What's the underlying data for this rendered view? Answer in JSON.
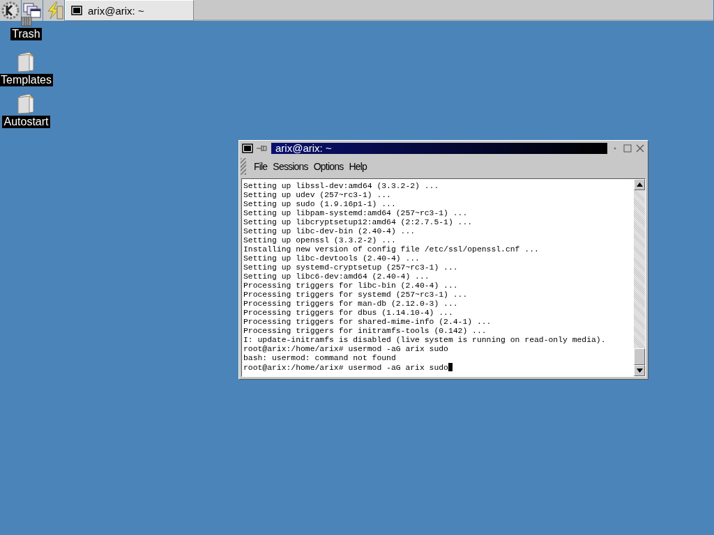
{
  "taskbar": {
    "launchers": [
      {
        "kind": "kmenu"
      },
      {
        "kind": "windows"
      },
      {
        "kind": "lightning"
      }
    ],
    "tasks": [
      {
        "title": "arix@arix: ~",
        "selected": true
      }
    ]
  },
  "desktop_icons": [
    {
      "label": "Trash",
      "kind": "trash"
    },
    {
      "label": "Templates",
      "kind": "folder"
    },
    {
      "label": "Autostart",
      "kind": "folder"
    }
  ],
  "window": {
    "title": "arix@arix: ~",
    "active": true,
    "menu": [
      "File",
      "Sessions",
      "Options",
      "Help"
    ],
    "lines": [
      "Setting up libssl-dev:amd64 (3.3.2-2) ...",
      "Setting up udev (257~rc3-1) ...",
      "Setting up sudo (1.9.16p1-1) ...",
      "Setting up libpam-systemd:amd64 (257~rc3-1) ...",
      "Setting up libcryptsetup12:amd64 (2:2.7.5-1) ...",
      "Setting up libc-dev-bin (2.40-4) ...",
      "Setting up openssl (3.3.2-2) ...",
      "Installing new version of config file /etc/ssl/openssl.cnf ...",
      "Setting up libc-devtools (2.40-4) ...",
      "Setting up systemd-cryptsetup (257~rc3-1) ...",
      "Setting up libc6-dev:amd64 (2.40-4) ...",
      "Processing triggers for libc-bin (2.40-4) ...",
      "Processing triggers for systemd (257~rc3-1) ...",
      "Processing triggers for man-db (2.12.0-3) ...",
      "Processing triggers for dbus (1.14.10-4) ...",
      "Processing triggers for shared-mime-info (2.4-1) ...",
      "Processing triggers for initramfs-tools (0.142) ...",
      "I: update-initramfs is disabled (live system is running on read-only media).",
      "root@arix:/home/arix# usermod -aG arix sudo",
      "bash: usermod: command not found",
      "root@arix:/home/arix# usermod -aG arix sudo"
    ]
  }
}
